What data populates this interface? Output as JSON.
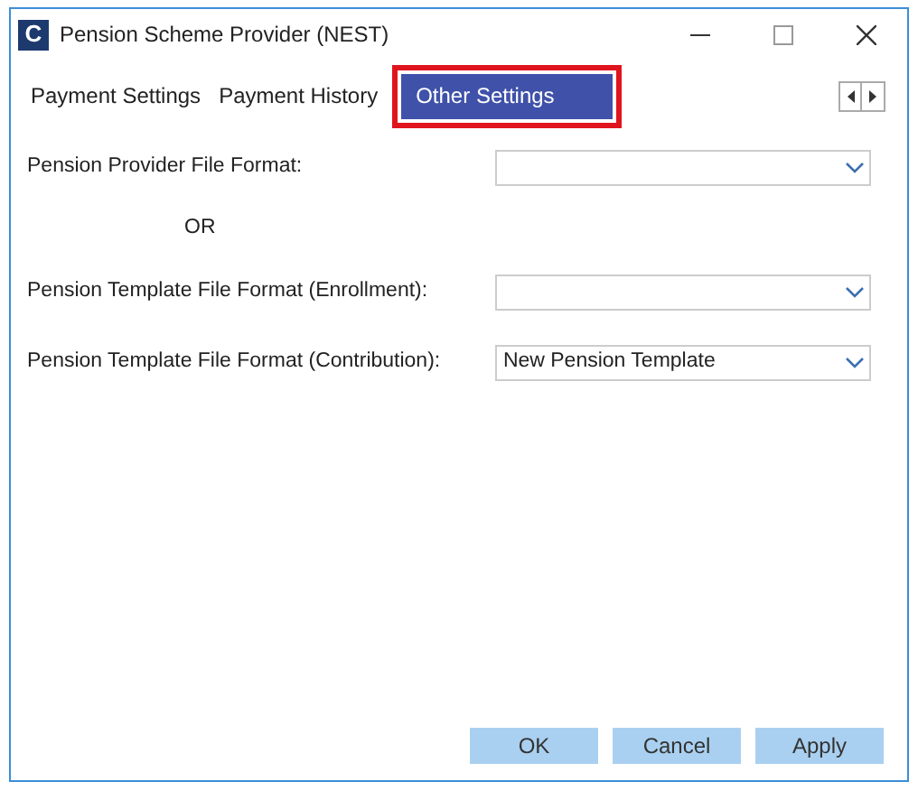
{
  "window": {
    "title": "Pension Scheme Provider (NEST)",
    "logo": "C"
  },
  "tabs": [
    {
      "label": "Payment Settings",
      "selected": false
    },
    {
      "label": "Payment History",
      "selected": false
    },
    {
      "label": "Other Settings",
      "selected": true
    }
  ],
  "form": [
    {
      "kind": "dropdown",
      "label": "Pension Provider File Format:"
    },
    {
      "kind": "separator",
      "label": "OR"
    },
    {
      "kind": "dropdown",
      "label": "Pension Template File Format (Enrollment):"
    },
    {
      "kind": "dropdown",
      "label": "Pension Template File Format (Contribution):",
      "value": "New Pension Template"
    }
  ],
  "buttons": [
    "OK",
    "Cancel",
    "Apply"
  ]
}
